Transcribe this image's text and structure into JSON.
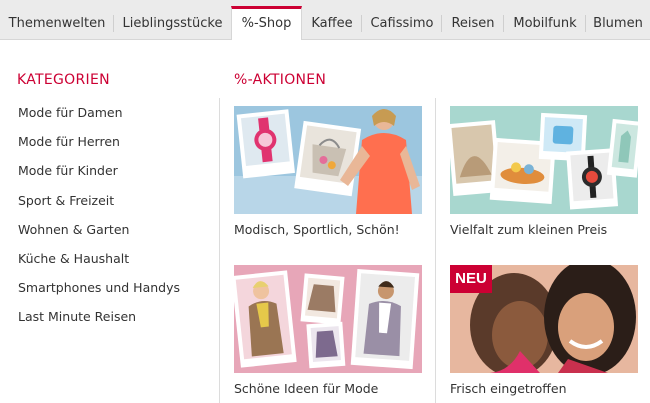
{
  "nav": {
    "tabs": [
      {
        "label": "Themenwelten"
      },
      {
        "label": "Lieblingsstücke"
      },
      {
        "label": "%-Shop"
      },
      {
        "label": "Kaffee"
      },
      {
        "label": "Cafissimo"
      },
      {
        "label": "Reisen"
      },
      {
        "label": "Mobilfunk"
      },
      {
        "label": "Blumen"
      }
    ],
    "active_tab": "%-Shop"
  },
  "categories": {
    "heading": "KATEGORIEN",
    "items": [
      {
        "label": "Mode für Damen"
      },
      {
        "label": "Mode für Herren"
      },
      {
        "label": "Mode für Kinder"
      },
      {
        "label": "Sport & Freizeit"
      },
      {
        "label": "Wohnen & Garten"
      },
      {
        "label": "Küche & Haushalt"
      },
      {
        "label": "Smartphones und Handys"
      },
      {
        "label": "Last Minute Reisen"
      }
    ]
  },
  "promotions": {
    "heading": "%-AKTIONEN",
    "tiles": [
      {
        "caption": "Modisch, Sportlich, Schön!"
      },
      {
        "caption": "Vielfalt zum kleinen Preis"
      },
      {
        "caption": "Schöne Ideen für Mode"
      },
      {
        "caption": "Frisch eingetroffen",
        "badge": "NEU"
      }
    ]
  },
  "colors": {
    "accent": "#cc0033",
    "nav_bg": "#ebebeb"
  }
}
